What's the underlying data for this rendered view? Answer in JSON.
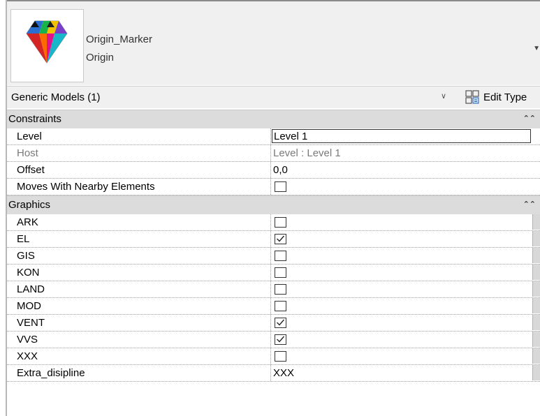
{
  "header": {
    "family_name": "Origin_Marker",
    "type_name": "Origin",
    "icon": "gem-icon",
    "chevron_icon": "chevron-down-icon"
  },
  "category": {
    "label": "Generic Models (1)",
    "dropdown_icon": "chevron-down-icon",
    "edit_type_label": "Edit Type",
    "edit_type_icon": "edit-type-icon"
  },
  "constraints": {
    "title": "Constraints",
    "collapse_icon": "double-chevron-up-icon",
    "level": {
      "name": "Level",
      "value": "Level 1"
    },
    "host": {
      "name": "Host",
      "value": "Level : Level 1"
    },
    "offset": {
      "name": "Offset",
      "value": "0,0"
    },
    "moves": {
      "name": "Moves With Nearby Elements",
      "checked": false
    }
  },
  "graphics": {
    "title": "Graphics",
    "collapse_icon": "double-chevron-up-icon",
    "ark": {
      "name": "ARK",
      "checked": false
    },
    "el": {
      "name": "EL",
      "checked": true
    },
    "gis": {
      "name": "GIS",
      "checked": false
    },
    "kon": {
      "name": "KON",
      "checked": false
    },
    "land": {
      "name": "LAND",
      "checked": false
    },
    "mod": {
      "name": "MOD",
      "checked": false
    },
    "vent": {
      "name": "VENT",
      "checked": true
    },
    "vvs": {
      "name": "VVS",
      "checked": true
    },
    "xxx": {
      "name": "XXX",
      "checked": false
    },
    "extra": {
      "name": "Extra_disipline",
      "value": "XXX"
    }
  },
  "colors": {
    "panel_bg": "#f0f0f0",
    "group_header_bg": "#dcdcdc",
    "row_border": "#9a9a9a",
    "dim_text": "#7a7a7a"
  }
}
